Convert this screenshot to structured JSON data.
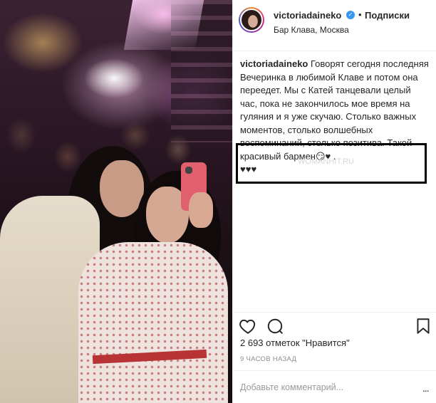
{
  "post": {
    "username": "victoriadaineko",
    "verified_icon": "verified-badge-icon",
    "separator": "•",
    "follow_label": "Подписки",
    "location": "Бар Клава, Москва"
  },
  "caption": {
    "username": "victoriadaineko",
    "text": "Говорят сегодня последняя Вечеринка в любимой Клаве и потом она переедет. Мы с Катей танцевали целый час, пока не закончилось мое время на гуляния и я уже скучаю. Столько важных моментов, столько волшебных воспоминаний, столько позитива. Такой красивый бармен😏♥ .",
    "hearts": "♥♥♥"
  },
  "watermark": "WOMANHIT.RU",
  "actions": {
    "like_icon": "heart-icon",
    "comment_icon": "comment-icon",
    "save_icon": "bookmark-icon"
  },
  "stats": {
    "likes": "2 693 отметок \"Нравится\"",
    "time": "9 ЧАСОВ НАЗАД"
  },
  "comment": {
    "placeholder": "Добавьте комментарий...",
    "more": "..."
  },
  "colors": {
    "verified": "#3897f0",
    "border": "#efefef",
    "muted": "#8e8e8e",
    "highlight_box": "#000000"
  }
}
